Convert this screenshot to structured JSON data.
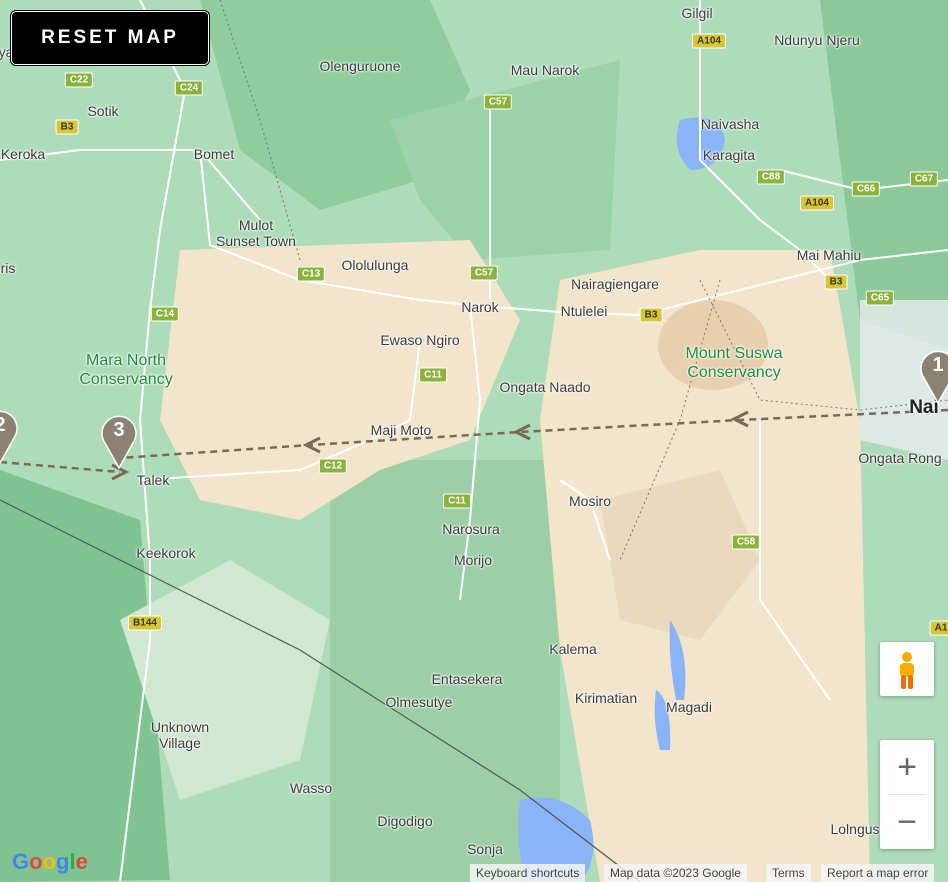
{
  "reset_button": "RESET MAP",
  "places": {
    "gilgil": "Gilgil",
    "ndunyu_njeru": "Ndunyu Njeru",
    "olenguruone": "Olenguruone",
    "mau_narok": "Mau Narok",
    "sotik": "Sotik",
    "keroka": "Keroka",
    "bomet": "Bomet",
    "naivasha": "Naivasha",
    "karagita": "Karagita",
    "mulot": "Mulot\nSunset Town",
    "ololulunga": "Ololulunga",
    "mai_mahiu": "Mai Mahiu",
    "nairagiengare": "Nairagiengare",
    "narok": "Narok",
    "ntulelei": "Ntulelei",
    "ewaso_ngiro": "Ewaso Ngiro",
    "ongata_naado": "Ongata Naado",
    "maji_moto": "Maji Moto",
    "talek": "Talek",
    "ongata_rongai": "Ongata Rong",
    "nairobi": "Nai",
    "mosiro": "Mosiro",
    "narosura": "Narosura",
    "morijo": "Morijo",
    "keekorok": "Keekorok",
    "kalema": "Kalema",
    "entasekera": "Entasekera",
    "olmesutye": "Olmesutye",
    "kirimatian": "Kirimatian",
    "magadi": "Magadi",
    "unknown_village": "Unknown\nVillage",
    "wasso": "Wasso",
    "digodigo": "Digodigo",
    "sonja": "Sonja",
    "lolngus": "Lolngus",
    "ris": "ris",
    "ya": "ya"
  },
  "parks": {
    "mara_north": "Mara North\nConservancy",
    "mount_suswa": "Mount Suswa\nConservancy"
  },
  "roads": {
    "c22": "C22",
    "c24": "C24",
    "b3a": "B3",
    "a104a": "A104",
    "c57a": "C57",
    "c88": "C88",
    "a104b": "A104",
    "c66": "C66",
    "c67": "C67",
    "c13": "C13",
    "c57b": "C57",
    "b3b": "B3",
    "c65": "C65",
    "c14": "C14",
    "b3c": "B3",
    "c11a": "C11",
    "c12": "C12",
    "c11b": "C11",
    "c58": "C58",
    "b144": "B144",
    "a1": "A1"
  },
  "markers": [
    "1",
    "2",
    "3"
  ],
  "controls": {
    "zoom_in": "+",
    "zoom_out": "−"
  },
  "attribution": {
    "keyboard": "Keyboard shortcuts",
    "map_data": "Map data ©2023 Google",
    "terms": "Terms",
    "report": "Report a map error"
  },
  "google_logo": "Google",
  "colors": {
    "forest": "#a8dab5",
    "sand": "#f5e6cf",
    "water": "#8ab4f8",
    "route": "#7a6a55",
    "marker": "#8c8273"
  }
}
